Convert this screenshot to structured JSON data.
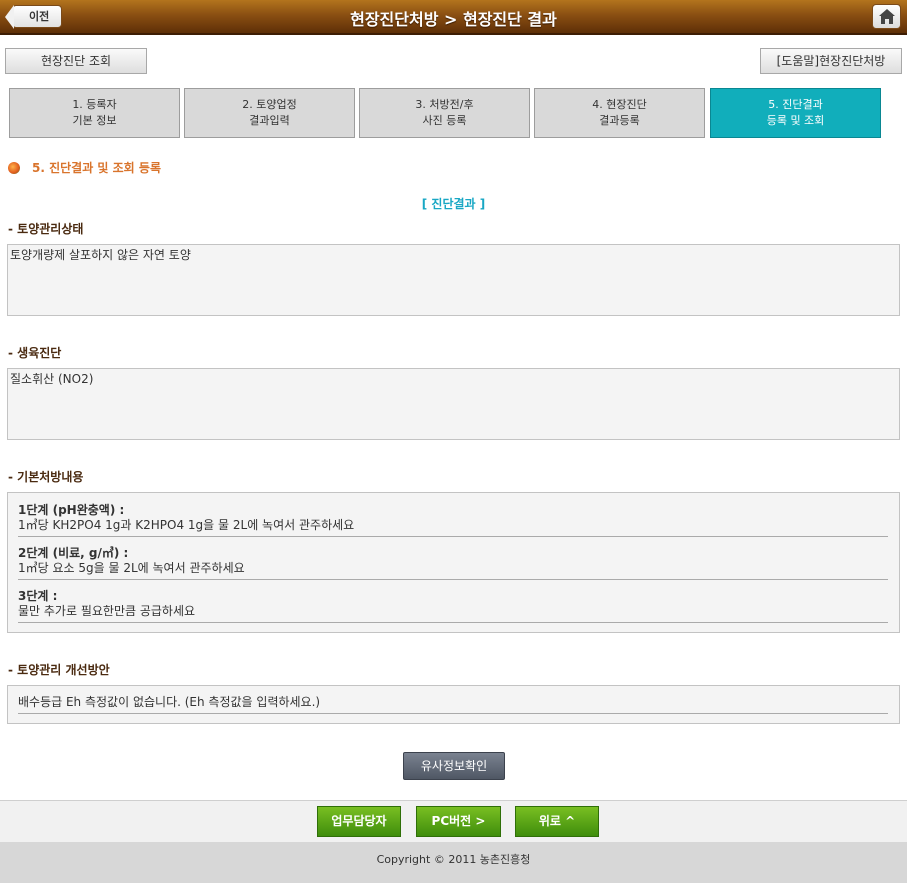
{
  "header": {
    "back_label": "이전",
    "title": "현장진단처방 > 현장진단 결과"
  },
  "top_buttons": {
    "query": "현장진단 조회",
    "help": "[도움말]현장진단처방"
  },
  "steps": [
    {
      "line1": "1. 등록자",
      "line2": "기본 정보"
    },
    {
      "line1": "2. 토양업정",
      "line2": "결과입력"
    },
    {
      "line1": "3. 처방전/후",
      "line2": "사진 등록"
    },
    {
      "line1": "4. 현장진단",
      "line2": "결과등록"
    },
    {
      "line1": "5. 진단결과",
      "line2": "등록 및 조회"
    }
  ],
  "section_title": "5. 진단결과 및 조회 등록",
  "result_heading": "[ 진단결과 ]",
  "soil_status": {
    "label": "- 토양관리상태",
    "value": "토양개량제 살포하지 않은 자연 토양"
  },
  "growth_diag": {
    "label": "- 생육진단",
    "value": "질소휘산 (NO2)"
  },
  "basic_rx": {
    "label": "- 기본처방내용",
    "items": [
      {
        "title": "1단계 (pH완충액) :",
        "text": "1㎥당 KH2PO4 1g과 K2HPO4 1g을 물 2L에 녹여서 관주하세요"
      },
      {
        "title": "2단계 (비료, g/㎥) :",
        "text": "1㎥당 요소 5g을 물 2L에 녹여서 관주하세요"
      },
      {
        "title": "3단계 :",
        "text": "물만 추가로 필요한만큼 공급하세요"
      }
    ]
  },
  "improvement": {
    "label": "- 토양관리 개선방안",
    "value": "배수등급 Eh 측정값이 없습니다. (Eh 측정값을 입력하세요.)"
  },
  "similar_button": "유사정보확인",
  "bottom_buttons": {
    "manager": "업무담당자",
    "pc": "PC버전 >",
    "top": "위로 ^"
  },
  "footer": "Copyright © 2011 농촌진흥청",
  "colors": {
    "header": "#8a4f12",
    "active_step": "#11aebb",
    "section_title": "#d9742c",
    "result_heading": "#18a7c4",
    "green_button": "#4f9d12"
  }
}
